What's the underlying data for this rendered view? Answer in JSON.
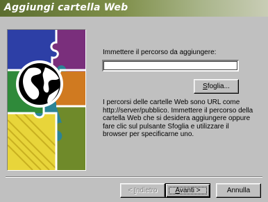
{
  "window": {
    "title": "Aggiungi cartella Web"
  },
  "form": {
    "prompt_label": "Immettere il percorso da aggiungere:",
    "path_value": "",
    "browse_button": {
      "mnemonic": "S",
      "rest": "foglia..."
    },
    "description": "I percorsi delle cartelle Web sono URL come http://server/pubblico. Immettere il percorso della cartella Web che si desidera aggiungere oppure fare clic sul pulsante Sfoglia e utilizzare il browser per specificarne uno."
  },
  "buttons": {
    "back": {
      "prefix": "< ",
      "mnemonic": "I",
      "rest": "ndietro",
      "enabled": false
    },
    "next": {
      "mnemonic": "A",
      "rest": "vanti >",
      "enabled": true,
      "default": true
    },
    "cancel": {
      "label": "Annulla",
      "enabled": true
    }
  },
  "colors": {
    "dialog_face": "#c0c0c0",
    "title_gradient_start": "#5b6d2f",
    "title_gradient_end": "#c9cdb6",
    "title_text": "#ffffff"
  },
  "icons": {
    "wizard_art": "globe-puzzle-illustration"
  }
}
